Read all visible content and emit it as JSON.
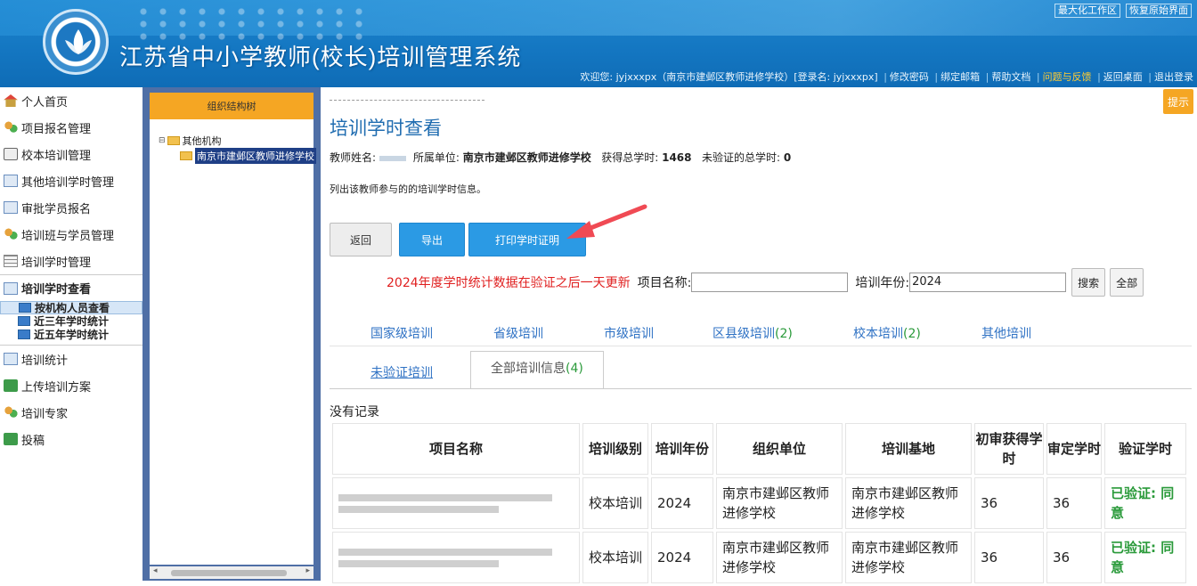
{
  "header": {
    "title": "江苏省中小学教师(校长)培训管理系统",
    "top_links": [
      "最大化工作区",
      "恢复原始界面"
    ],
    "welcome": "欢迎您: jyjxxxpx（南京市建邺区教师进修学校）[登录名: jyjxxxpx]",
    "links": [
      "修改密码",
      "绑定邮箱",
      "帮助文档",
      "问题与反馈",
      "返回桌面",
      "退出登录"
    ],
    "accent": "#1477c2"
  },
  "nav": {
    "items": [
      {
        "label": "个人首页",
        "icon": "home-icon"
      },
      {
        "label": "项目报名管理",
        "icon": "users-icon"
      },
      {
        "label": "校本培训管理",
        "icon": "school-icon"
      },
      {
        "label": "其他培训学时管理",
        "icon": "edit-icon"
      },
      {
        "label": "审批学员报名",
        "icon": "edit-icon"
      },
      {
        "label": "培训班与学员管理",
        "icon": "users-icon"
      },
      {
        "label": "培训学时管理",
        "icon": "table-icon"
      },
      {
        "label": "培训学时查看",
        "icon": "chart-icon"
      }
    ],
    "subitems": [
      "按机构人员查看",
      "近三年学时统计",
      "近五年学时统计"
    ],
    "items_after": [
      {
        "label": "培训统计",
        "icon": "chart-icon"
      },
      {
        "label": "上传培训方案",
        "icon": "upload-icon"
      },
      {
        "label": "培训专家",
        "icon": "users-icon"
      },
      {
        "label": "投稿",
        "icon": "upload-icon"
      }
    ]
  },
  "tree": {
    "header": "组织结构树",
    "root": "其他机构",
    "child": "南京市建邺区教师进修学校"
  },
  "main": {
    "title": "培训学时查看",
    "teacher_label": "教师姓名:",
    "unit_label": "所属单位:",
    "unit_value": "南京市建邺区教师进修学校",
    "total_label": "获得总学时:",
    "total_value": "1468",
    "unverified_label": "未验证的总学时:",
    "unverified_value": "0",
    "desc": "列出该教师参与的的培训学时信息。",
    "tip": "提示",
    "buttons": {
      "back": "返回",
      "export": "导出",
      "print": "打印学时证明"
    },
    "notice": "2024年度学时统计数据在验证之后一天更新",
    "project_label": "项目名称:",
    "project_value": "",
    "year_label": "培训年份:",
    "year_value": "2024",
    "search": "搜索",
    "all": "全部",
    "tabs_row1": [
      {
        "label": "国家级培训",
        "count": ""
      },
      {
        "label": "省级培训",
        "count": ""
      },
      {
        "label": "市级培训",
        "count": ""
      },
      {
        "label": "区县级培训",
        "count": "(2)"
      },
      {
        "label": "校本培训",
        "count": "(2)"
      },
      {
        "label": "其他培训",
        "count": ""
      }
    ],
    "tab_unverified": "未验证培训",
    "tab_all": {
      "label": "全部培训信息",
      "count": "(4)"
    },
    "no_records": "没有记录"
  },
  "table": {
    "headers": [
      "项目名称",
      "培训级别",
      "培训年份",
      "组织单位",
      "培训基地",
      "初审获得学时",
      "审定学时",
      "验证学时"
    ],
    "rows": [
      {
        "level": "校本培训",
        "year": "2024",
        "org": "南京市建邺区教师进修学校",
        "base": "南京市建邺区教师进修学校",
        "initial": "36",
        "approved": "36",
        "verify": "已验证: 同意"
      },
      {
        "level": "校本培训",
        "year": "2024",
        "org": "南京市建邺区教师进修学校",
        "base": "南京市建邺区教师进修学校",
        "initial": "36",
        "approved": "36",
        "verify": "已验证: 同意"
      }
    ]
  }
}
